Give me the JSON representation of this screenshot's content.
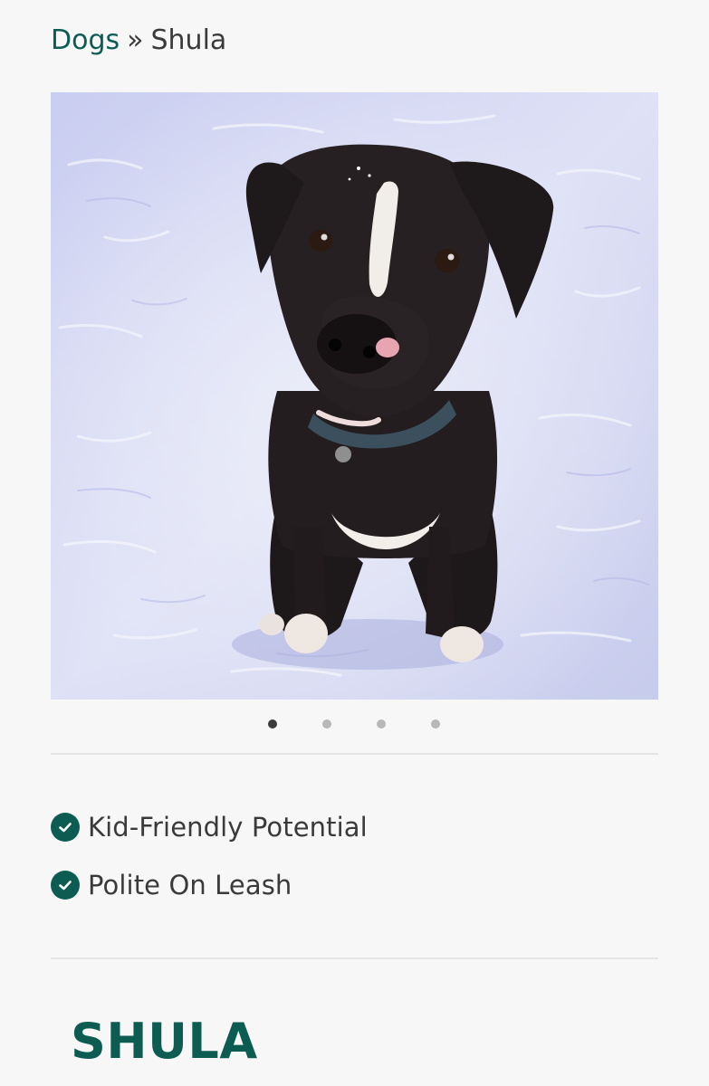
{
  "breadcrumb": {
    "parent_label": "Dogs",
    "separator": "»",
    "current_label": "Shula"
  },
  "gallery": {
    "image_alt": "Black and white dog sitting in the snow",
    "slide_count": 4,
    "active_slide": 1
  },
  "traits": [
    {
      "label": "Kid-Friendly Potential",
      "icon": "check-circle-icon"
    },
    {
      "label": "Polite On Leash",
      "icon": "check-circle-icon"
    }
  ],
  "profile": {
    "name": "SHULA"
  },
  "colors": {
    "brand_green": "#0d5c52",
    "text_dark": "#3a3a3a",
    "dot_active": "#3b3b3b",
    "dot_inactive": "#b8b8b8",
    "background": "#f7f7f8"
  }
}
